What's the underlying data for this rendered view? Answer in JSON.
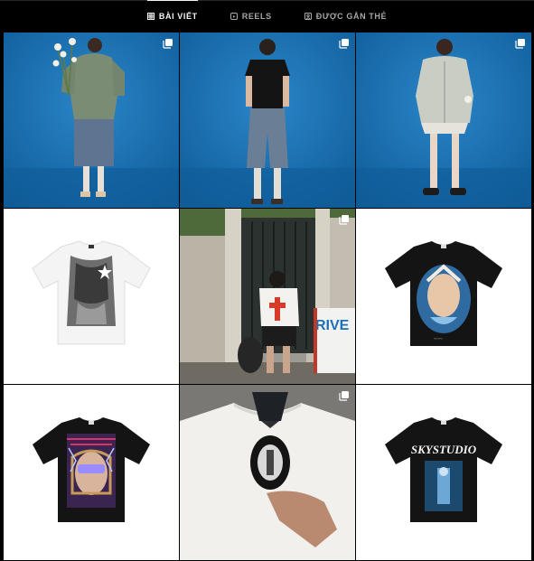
{
  "tabs": [
    {
      "label": "BÀI VIẾT",
      "icon": "grid-icon",
      "active": true
    },
    {
      "label": "REELS",
      "icon": "reels-icon",
      "active": false
    },
    {
      "label": "ĐƯỢC GẮN THẺ",
      "icon": "tagged-icon",
      "active": false
    }
  ],
  "posts": [
    {
      "subject": "model in green hoodie with flowers",
      "multi": true
    },
    {
      "subject": "model in black tee and denim shorts",
      "multi": true
    },
    {
      "subject": "model in grey zip hoodie",
      "multi": true
    },
    {
      "subject": "white tee with graphic print",
      "multi": false
    },
    {
      "subject": "man carrying bags on street",
      "multi": true,
      "sign_text": "RIVE"
    },
    {
      "subject": "black tee with mermaid graphic",
      "multi": false
    },
    {
      "subject": "black tee with cyber girl graphic",
      "multi": false
    },
    {
      "subject": "ironing a white tee",
      "multi": true
    },
    {
      "subject": "black tee with SKYSTUDIO graphic",
      "multi": false,
      "print_text": "SKYSTUDIO"
    }
  ],
  "colors": {
    "studio_blue": "#1a6fb0",
    "background": "#000000",
    "tab_active": "#f5f5f5",
    "tab_inactive": "#a8a8a8"
  }
}
